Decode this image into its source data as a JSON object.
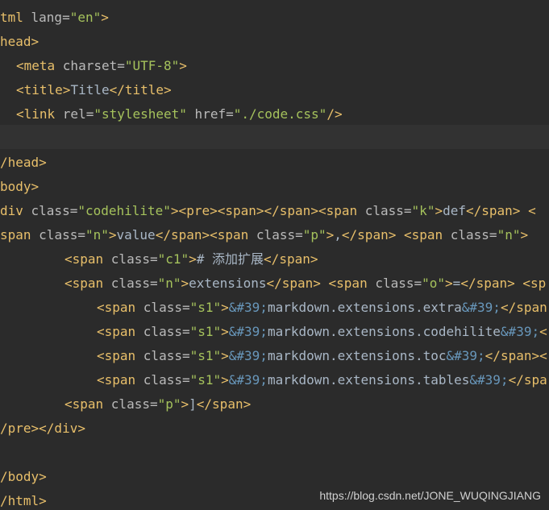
{
  "editor": {
    "lines": [
      {
        "indent": 0,
        "tokens": [
          {
            "t": "tag",
            "v": "tml "
          },
          {
            "t": "attr",
            "v": "lang="
          },
          {
            "t": "str",
            "v": "\"en\""
          },
          {
            "t": "tag",
            "v": ">"
          }
        ]
      },
      {
        "indent": 0,
        "tokens": [
          {
            "t": "tag",
            "v": "head>"
          }
        ]
      },
      {
        "indent": 2,
        "tokens": [
          {
            "t": "tag",
            "v": "<meta "
          },
          {
            "t": "attr",
            "v": "charset="
          },
          {
            "t": "str",
            "v": "\"UTF-8\""
          },
          {
            "t": "tag",
            "v": ">"
          }
        ]
      },
      {
        "indent": 2,
        "tokens": [
          {
            "t": "tag",
            "v": "<title>"
          },
          {
            "t": "txt",
            "v": "Title"
          },
          {
            "t": "tag",
            "v": "</title>"
          }
        ]
      },
      {
        "indent": 2,
        "tokens": [
          {
            "t": "tag",
            "v": "<link "
          },
          {
            "t": "attr",
            "v": "rel="
          },
          {
            "t": "str",
            "v": "\"stylesheet\""
          },
          {
            "t": "attr",
            "v": " href="
          },
          {
            "t": "str",
            "v": "\"./code.css\""
          },
          {
            "t": "tag",
            "v": "/>"
          }
        ]
      },
      {
        "indent": 0,
        "tokens": []
      },
      {
        "indent": 0,
        "tokens": [
          {
            "t": "tag",
            "v": "/head>"
          }
        ]
      },
      {
        "indent": 0,
        "tokens": [
          {
            "t": "tag",
            "v": "body>"
          }
        ]
      },
      {
        "indent": 0,
        "tokens": [
          {
            "t": "tag",
            "v": "div "
          },
          {
            "t": "attr",
            "v": "class="
          },
          {
            "t": "str",
            "v": "\"codehilite\""
          },
          {
            "t": "tag",
            "v": "><pre><span></span><span "
          },
          {
            "t": "attr",
            "v": "class="
          },
          {
            "t": "str",
            "v": "\"k\""
          },
          {
            "t": "tag",
            "v": ">"
          },
          {
            "t": "txt",
            "v": "def"
          },
          {
            "t": "tag",
            "v": "</span> <"
          }
        ]
      },
      {
        "indent": 0,
        "tokens": [
          {
            "t": "tag",
            "v": "span "
          },
          {
            "t": "attr",
            "v": "class="
          },
          {
            "t": "str",
            "v": "\"n\""
          },
          {
            "t": "tag",
            "v": ">"
          },
          {
            "t": "txt",
            "v": "value"
          },
          {
            "t": "tag",
            "v": "</span><span "
          },
          {
            "t": "attr",
            "v": "class="
          },
          {
            "t": "str",
            "v": "\"p\""
          },
          {
            "t": "tag",
            "v": ">"
          },
          {
            "t": "txt",
            "v": ","
          },
          {
            "t": "tag",
            "v": "</span> <span "
          },
          {
            "t": "attr",
            "v": "class="
          },
          {
            "t": "str",
            "v": "\"n\""
          },
          {
            "t": "tag",
            "v": ">"
          }
        ]
      },
      {
        "indent": 8,
        "tokens": [
          {
            "t": "tag",
            "v": "<span "
          },
          {
            "t": "attr",
            "v": "class="
          },
          {
            "t": "str",
            "v": "\"c1\""
          },
          {
            "t": "tag",
            "v": ">"
          },
          {
            "t": "txt",
            "v": "# 添加扩展"
          },
          {
            "t": "tag",
            "v": "</span>"
          }
        ]
      },
      {
        "indent": 8,
        "tokens": [
          {
            "t": "tag",
            "v": "<span "
          },
          {
            "t": "attr",
            "v": "class="
          },
          {
            "t": "str",
            "v": "\"n\""
          },
          {
            "t": "tag",
            "v": ">"
          },
          {
            "t": "txt",
            "v": "extensions"
          },
          {
            "t": "tag",
            "v": "</span> <span "
          },
          {
            "t": "attr",
            "v": "class="
          },
          {
            "t": "str",
            "v": "\"o\""
          },
          {
            "t": "tag",
            "v": ">"
          },
          {
            "t": "txt",
            "v": "="
          },
          {
            "t": "tag",
            "v": "</span> <sp"
          }
        ]
      },
      {
        "indent": 12,
        "tokens": [
          {
            "t": "tag",
            "v": "<span "
          },
          {
            "t": "attr",
            "v": "class="
          },
          {
            "t": "str",
            "v": "\"s1\""
          },
          {
            "t": "tag",
            "v": ">"
          },
          {
            "t": "ent",
            "v": "&#39;"
          },
          {
            "t": "txt",
            "v": "markdown.extensions.extra"
          },
          {
            "t": "ent",
            "v": "&#39;"
          },
          {
            "t": "tag",
            "v": "</span"
          }
        ]
      },
      {
        "indent": 12,
        "tokens": [
          {
            "t": "tag",
            "v": "<span "
          },
          {
            "t": "attr",
            "v": "class="
          },
          {
            "t": "str",
            "v": "\"s1\""
          },
          {
            "t": "tag",
            "v": ">"
          },
          {
            "t": "ent",
            "v": "&#39;"
          },
          {
            "t": "txt",
            "v": "markdown.extensions.codehilite"
          },
          {
            "t": "ent",
            "v": "&#39;"
          },
          {
            "t": "tag",
            "v": "<"
          }
        ]
      },
      {
        "indent": 12,
        "tokens": [
          {
            "t": "tag",
            "v": "<span "
          },
          {
            "t": "attr",
            "v": "class="
          },
          {
            "t": "str",
            "v": "\"s1\""
          },
          {
            "t": "tag",
            "v": ">"
          },
          {
            "t": "ent",
            "v": "&#39;"
          },
          {
            "t": "txt",
            "v": "markdown.extensions.toc"
          },
          {
            "t": "ent",
            "v": "&#39;"
          },
          {
            "t": "tag",
            "v": "</span><"
          }
        ]
      },
      {
        "indent": 12,
        "tokens": [
          {
            "t": "tag",
            "v": "<span "
          },
          {
            "t": "attr",
            "v": "class="
          },
          {
            "t": "str",
            "v": "\"s1\""
          },
          {
            "t": "tag",
            "v": ">"
          },
          {
            "t": "ent",
            "v": "&#39;"
          },
          {
            "t": "txt",
            "v": "markdown.extensions.tables"
          },
          {
            "t": "ent",
            "v": "&#39;"
          },
          {
            "t": "tag",
            "v": "</spa"
          }
        ]
      },
      {
        "indent": 8,
        "tokens": [
          {
            "t": "tag",
            "v": "<span "
          },
          {
            "t": "attr",
            "v": "class="
          },
          {
            "t": "str",
            "v": "\"p\""
          },
          {
            "t": "tag",
            "v": ">"
          },
          {
            "t": "txt",
            "v": "]"
          },
          {
            "t": "tag",
            "v": "</span>"
          }
        ]
      },
      {
        "indent": 0,
        "tokens": [
          {
            "t": "tag",
            "v": "/pre></div>"
          }
        ]
      },
      {
        "indent": 0,
        "tokens": []
      },
      {
        "indent": 0,
        "tokens": [
          {
            "t": "tag",
            "v": "/body>"
          }
        ]
      },
      {
        "indent": 0,
        "tokens": [
          {
            "t": "tag",
            "v": "/html>"
          }
        ]
      }
    ]
  },
  "watermark": "https://blog.csdn.net/JONE_WUQINGJIANG"
}
